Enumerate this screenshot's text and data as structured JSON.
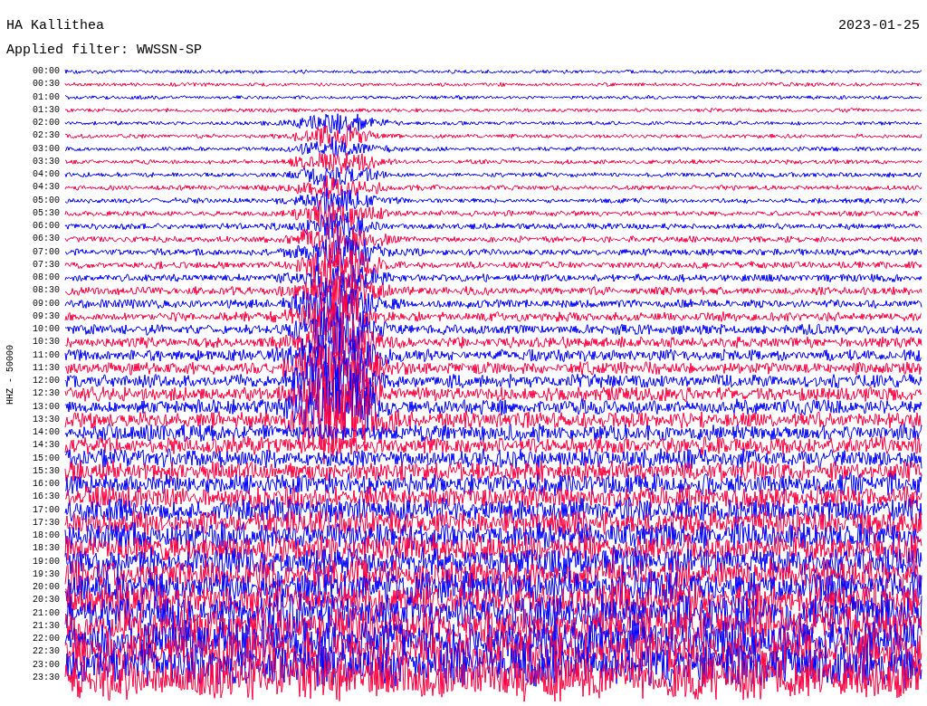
{
  "header": {
    "station": "HA Kallithea",
    "date": "2023-01-25",
    "filter": "Applied filter: WWSSN-SP"
  },
  "axis_label": "HHZ - 50000",
  "traces": [
    {
      "time": "00:00",
      "color": "#0000ff"
    },
    {
      "time": "00:30",
      "color": "#ff0040"
    },
    {
      "time": "01:00",
      "color": "#0000ff"
    },
    {
      "time": "01:30",
      "color": "#ff0040"
    },
    {
      "time": "02:00",
      "color": "#0000ff"
    },
    {
      "time": "02:30",
      "color": "#ff0040"
    },
    {
      "time": "03:00",
      "color": "#0000ff"
    },
    {
      "time": "03:30",
      "color": "#ff0040"
    },
    {
      "time": "04:00",
      "color": "#0000ff"
    },
    {
      "time": "04:30",
      "color": "#ff0040"
    },
    {
      "time": "05:00",
      "color": "#0000ff"
    },
    {
      "time": "05:30",
      "color": "#ff0040"
    },
    {
      "time": "06:00",
      "color": "#0000ff"
    },
    {
      "time": "06:30",
      "color": "#ff0040"
    },
    {
      "time": "07:00",
      "color": "#0000ff"
    },
    {
      "time": "07:30",
      "color": "#ff0040"
    },
    {
      "time": "08:00",
      "color": "#0000ff"
    },
    {
      "time": "08:30",
      "color": "#ff0040"
    },
    {
      "time": "09:00",
      "color": "#0000ff"
    },
    {
      "time": "09:30",
      "color": "#ff0040"
    },
    {
      "time": "10:00",
      "color": "#0000ff"
    },
    {
      "time": "10:30",
      "color": "#ff0040"
    },
    {
      "time": "11:00",
      "color": "#0000ff"
    },
    {
      "time": "11:30",
      "color": "#ff0040"
    },
    {
      "time": "12:00",
      "color": "#0000ff"
    },
    {
      "time": "12:30",
      "color": "#ff0040"
    },
    {
      "time": "13:00",
      "color": "#0000ff"
    },
    {
      "time": "13:30",
      "color": "#ff0040"
    },
    {
      "time": "14:00",
      "color": "#0000ff"
    },
    {
      "time": "14:30",
      "color": "#ff0040"
    },
    {
      "time": "15:00",
      "color": "#0000ff"
    },
    {
      "time": "15:30",
      "color": "#ff0040"
    },
    {
      "time": "16:00",
      "color": "#0000ff"
    },
    {
      "time": "16:30",
      "color": "#ff0040"
    },
    {
      "time": "17:00",
      "color": "#0000ff"
    },
    {
      "time": "17:30",
      "color": "#ff0040"
    },
    {
      "time": "18:00",
      "color": "#0000ff"
    },
    {
      "time": "18:30",
      "color": "#ff0040"
    },
    {
      "time": "19:00",
      "color": "#0000ff"
    },
    {
      "time": "19:30",
      "color": "#ff0040"
    },
    {
      "time": "20:00",
      "color": "#0000ff"
    },
    {
      "time": "20:30",
      "color": "#ff0040"
    },
    {
      "time": "21:00",
      "color": "#0000ff"
    },
    {
      "time": "21:30",
      "color": "#ff0040"
    },
    {
      "time": "22:00",
      "color": "#0000ff"
    },
    {
      "time": "22:30",
      "color": "#ff0040"
    },
    {
      "time": "23:00",
      "color": "#0000ff"
    },
    {
      "time": "23:30",
      "color": "#ff0040"
    }
  ]
}
